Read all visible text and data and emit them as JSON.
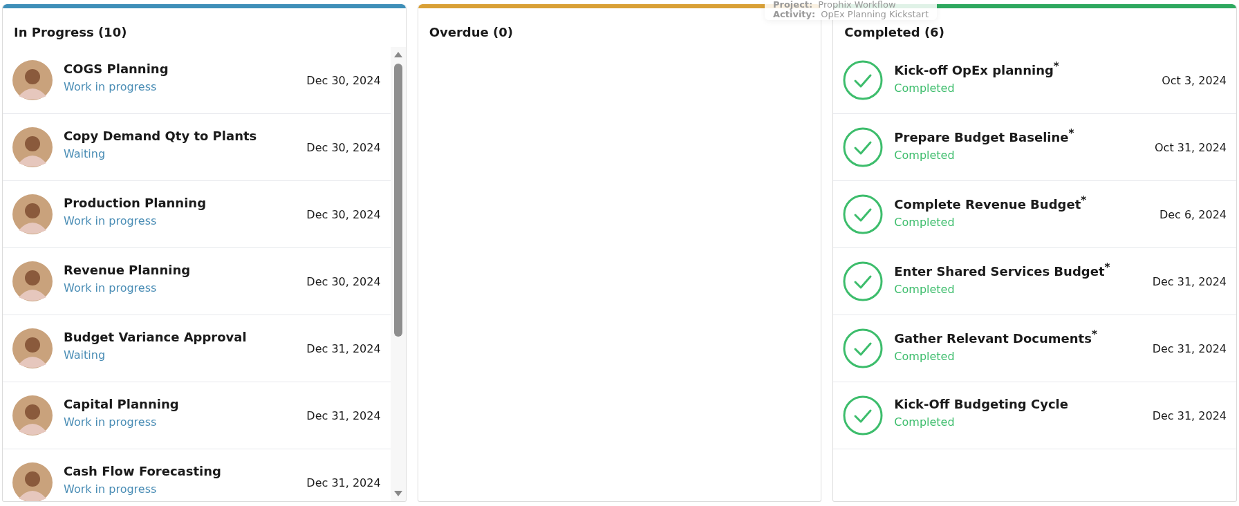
{
  "columns": [
    {
      "title": "In Progress (10)",
      "color": "#3f8fb8",
      "scrollable": true,
      "items": [
        {
          "kind": "person",
          "title": "COGS Planning",
          "status": "Work in progress",
          "date": "Dec 30, 2024"
        },
        {
          "kind": "person",
          "title": "Copy Demand Qty to Plants",
          "status": "Waiting",
          "date": "Dec 30, 2024"
        },
        {
          "kind": "person",
          "title": "Production Planning",
          "status": "Work in progress",
          "date": "Dec 30, 2024"
        },
        {
          "kind": "person",
          "title": "Revenue Planning",
          "status": "Work in progress",
          "date": "Dec 30, 2024"
        },
        {
          "kind": "person",
          "title": "Budget Variance Approval",
          "status": "Waiting",
          "date": "Dec 31, 2024"
        },
        {
          "kind": "person",
          "title": "Capital Planning",
          "status": "Work in progress",
          "date": "Dec 31, 2024"
        },
        {
          "kind": "person",
          "title": "Cash Flow Forecasting",
          "status": "Work in progress",
          "date": "Dec 31, 2024"
        }
      ]
    },
    {
      "title": "Overdue (0)",
      "color": "#d9a036",
      "scrollable": false
    },
    {
      "title": "Completed (6)",
      "color": "#2ea85f",
      "scrollable": false,
      "items": [
        {
          "kind": "done",
          "title": "Kick-off OpEx planning$^{*}$",
          "status": "Completed",
          "date": "Oct 3, 2024"
        },
        {
          "kind": "done",
          "title": "Prepare Budget Baseline$^{*}$",
          "status": "Completed",
          "date": "Oct 31, 2024"
        },
        {
          "kind": "done",
          "title": "Complete Revenue Budget$^{*}$",
          "status": "Completed",
          "date": "Dec 6, 2024"
        },
        {
          "kind": "done",
          "title": "Enter Shared Services Budget$^{*}$",
          "status": "Completed",
          "date": "Dec 31, 2024"
        },
        {
          "kind": "done",
          "title": "Gather Relevant Documents$^{*}$",
          "status": "Completed",
          "date": "Dec 31, 2024"
        },
        {
          "kind": "done",
          "title": "Kick-Off Budgeting Cycle",
          "status": "Completed",
          "date": "Dec 31, 2024"
        }
      ]
    }
  ],
  "tooltip": {
    "lines": [
      {
        "label": "Project:",
        "value": "Prophix Workflow"
      },
      {
        "label": "Activity:",
        "value": "OpEx Planning Kickstart"
      }
    ]
  }
}
